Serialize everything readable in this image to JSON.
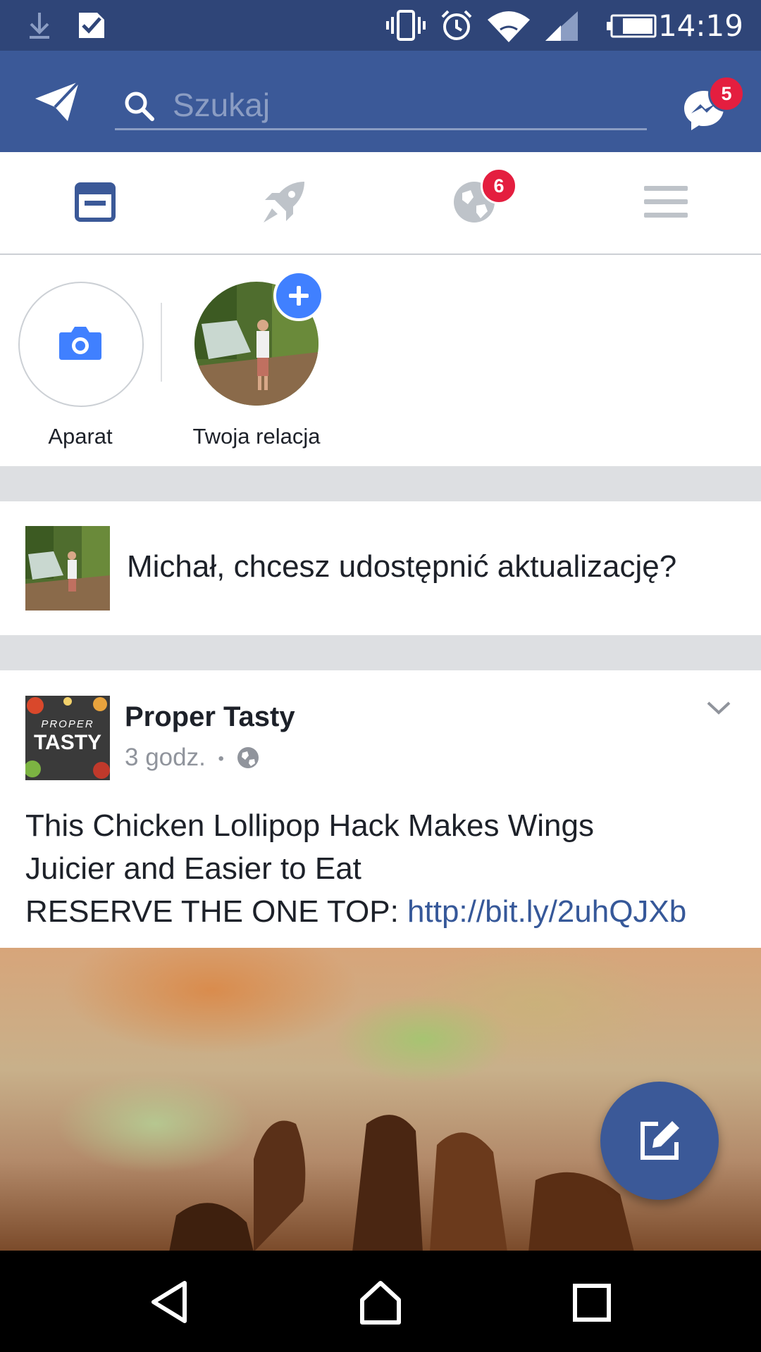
{
  "status_bar": {
    "time": "14:19"
  },
  "search": {
    "placeholder": "Szukaj"
  },
  "messenger": {
    "badge": "5"
  },
  "tabs": {
    "notifications_badge": "6"
  },
  "stories": [
    {
      "label": "Aparat"
    },
    {
      "label": "Twoja relacja"
    }
  ],
  "composer": {
    "prompt": "Michał, chcesz udostępnić aktualizację?"
  },
  "post": {
    "author": "Proper Tasty",
    "time": "3 godz.",
    "separator": "•",
    "text_line1": "This Chicken Lollipop Hack Makes Wings",
    "text_line2": "Juicier and Easier to Eat",
    "text_line3": "RESERVE THE ONE TOP: ",
    "link": "http://bit.ly/2uhQJXb",
    "logo_text_top": "PROPER",
    "logo_text_bottom": "TASTY"
  },
  "colors": {
    "brand": "#3b5998",
    "status": "#2f4578",
    "badge": "#e41e3f",
    "link": "#365899"
  }
}
